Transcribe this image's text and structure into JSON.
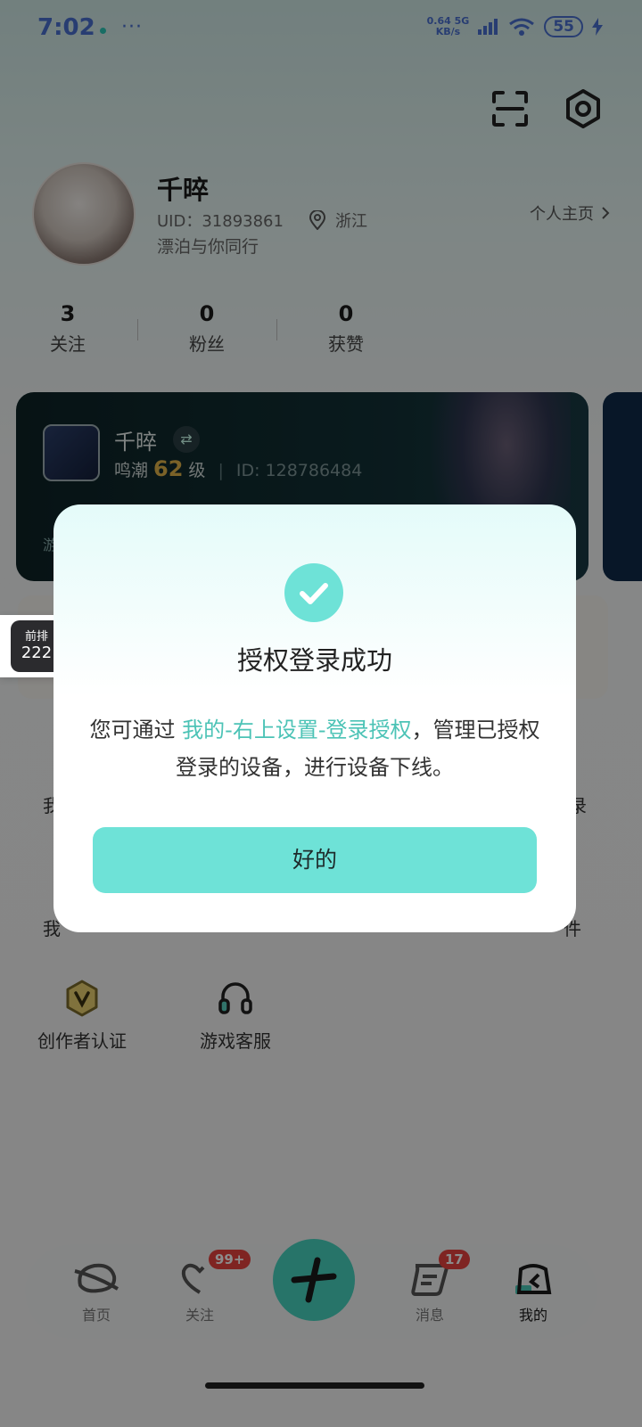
{
  "status_bar": {
    "time": "7:02",
    "more": "···",
    "net_speed_value": "0.64",
    "net_speed_unit": "KB/s",
    "net_type": "5G",
    "battery": "55"
  },
  "profile": {
    "name": "千晬",
    "uid": "UID：31893861",
    "location": "浙江",
    "motto": "漂泊与你同行",
    "homepage_link": "个人主页"
  },
  "stats": [
    {
      "value": "3",
      "label": "关注"
    },
    {
      "value": "0",
      "label": "粉丝"
    },
    {
      "value": "0",
      "label": "获赞"
    }
  ],
  "game_card": {
    "name": "千晬",
    "game": "鸣潮",
    "level": "62",
    "level_unit": "级",
    "id": "ID: 128786484",
    "bottom_text": "游"
  },
  "floating_badge": {
    "line1": "前排",
    "line2": "222"
  },
  "menu_partial": {
    "row1_left": "我",
    "row1_right": "录",
    "row2_left": "我",
    "row2_right": "件"
  },
  "menu_items": [
    {
      "label": "创作者认证",
      "icon": "verified-v-icon"
    },
    {
      "label": "游戏客服",
      "icon": "headset-icon"
    }
  ],
  "nav": {
    "home": "首页",
    "follow": "关注",
    "follow_badge": "99+",
    "messages": "消息",
    "messages_badge": "17",
    "mine": "我的"
  },
  "dialog": {
    "title": "授权登录成功",
    "body_prefix": "您可通过 ",
    "body_link": "我的-右上设置-登录授权",
    "body_suffix": "，管理已授权登录的设备，进行设备下线。",
    "ok_button": "好的"
  }
}
